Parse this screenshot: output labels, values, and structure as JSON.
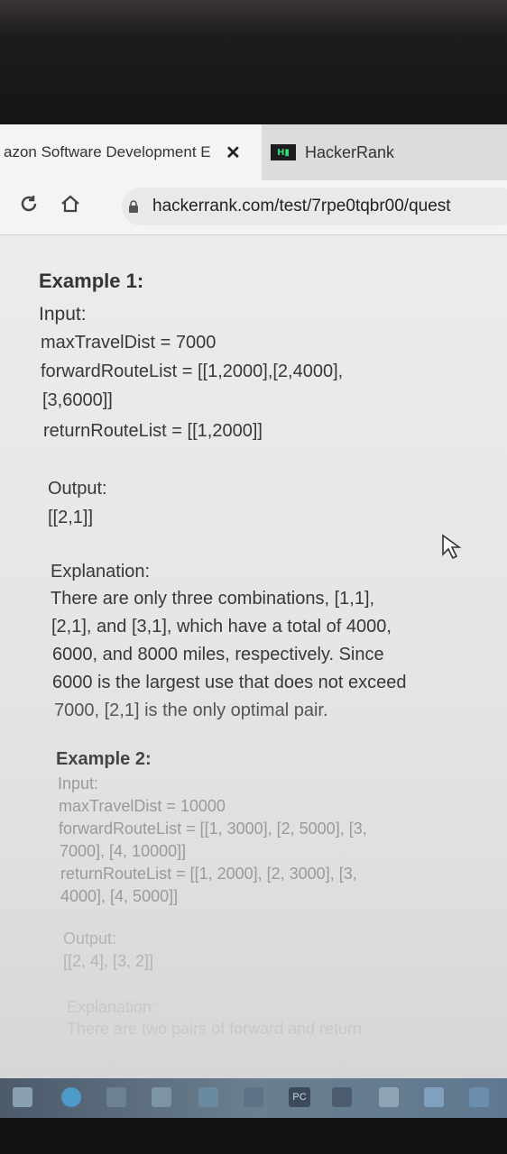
{
  "browser": {
    "active_tab": {
      "title": "azon Software Development E"
    },
    "other_tab": {
      "title": "HackerRank",
      "logo_text": "H▮"
    },
    "url": "hackerrank.com/test/7rpe0tqbr00/quest"
  },
  "example1": {
    "heading": "Example 1:",
    "input_label": "Input:",
    "max_travel": "maxTravelDist = 7000",
    "forward_1": "forwardRouteList = [[1,2000],[2,4000],",
    "forward_2": "[3,6000]]",
    "return_line": "returnRouteList = [[1,2000]]",
    "output_label": "Output:",
    "output_value": "[[2,1]]",
    "explanation_label": "Explanation:",
    "explanation_lines": [
      "There are only three combinations, [1,1],",
      "[2,1], and [3,1], which have a total of 4000,",
      "6000, and 8000 miles, respectively. Since",
      "6000 is the largest use that does not exceed",
      "7000, [2,1] is the only optimal pair."
    ]
  },
  "example2": {
    "heading": "Example 2:",
    "input_label": "Input:",
    "max_travel": "maxTravelDist = 10000",
    "forward_1": "forwardRouteList = [[1, 3000], [2, 5000], [3,",
    "forward_2": "7000], [4, 10000]]",
    "return_1": "returnRouteList = [[1, 2000], [2, 3000], [3,",
    "return_2": "4000], [4, 5000]]",
    "output_label": "Output:",
    "output_value": "[[2, 4], [3, 2]]",
    "explanation_label": "Explanation:",
    "explanation_line": "There are two pairs of forward and return"
  },
  "taskbar": {
    "pc_label": "PC"
  }
}
